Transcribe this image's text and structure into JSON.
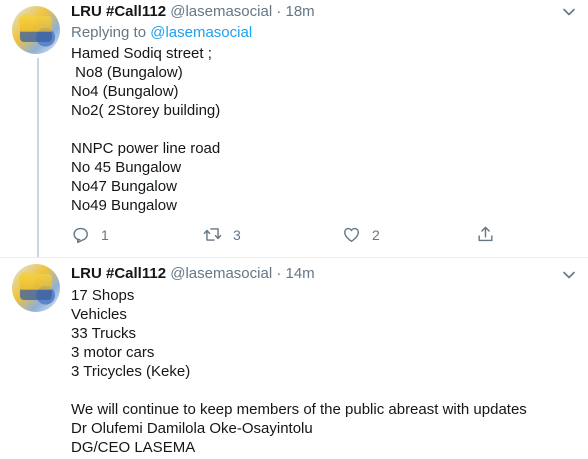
{
  "tweets": [
    {
      "name": "LRU #Call112",
      "handle": "@lasemasocial",
      "separator": "·",
      "time": "18m",
      "reply_prefix": "Replying to",
      "reply_mention": "@lasemasocial",
      "lines": [
        "Hamed Sodiq street ;",
        " No8 (Bungalow)",
        "No4 (Bungalow)",
        "No2( 2Storey building)",
        "",
        "NNPC power line road",
        "No 45 Bungalow",
        "No47 Bungalow",
        "No49 Bungalow"
      ],
      "replies": "1",
      "retweets": "3",
      "likes": "2"
    },
    {
      "name": "LRU #Call112",
      "handle": "@lasemasocial",
      "separator": "·",
      "time": "14m",
      "lines": [
        "17 Shops",
        "Vehicles",
        "33 Trucks",
        "3 motor cars",
        "3 Tricycles (Keke)",
        "",
        "We will continue to keep members of the public abreast with updates",
        "Dr Olufemi Damilola Oke-Osayintolu",
        "DG/CEO LASEMA"
      ]
    }
  ],
  "icons": {
    "reply": "reply-icon",
    "retweet": "retweet-icon",
    "like": "heart-icon",
    "share": "share-icon",
    "menu": "chevron-down-icon"
  },
  "colors": {
    "secondary_text": "#657786",
    "link": "#1da1f2",
    "thread_line": "#ccd6dd"
  }
}
